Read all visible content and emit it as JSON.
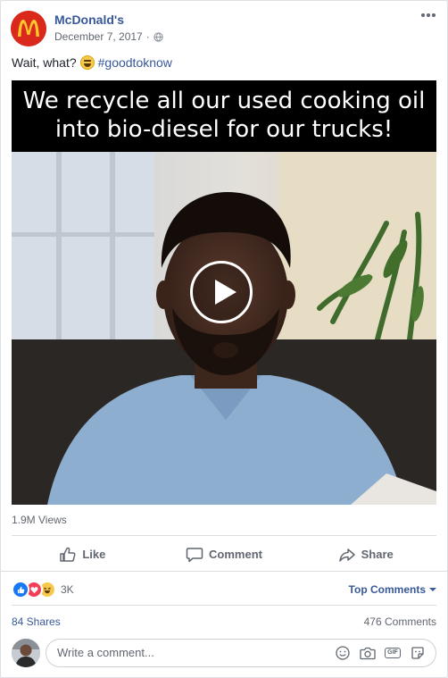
{
  "post": {
    "page_name": "McDonald's",
    "date": "December 7, 2017",
    "privacy_icon": "globe-icon",
    "more_icon": "ellipsis-icon",
    "caption_text": "Wait, what?",
    "caption_emoji": "laughing-face",
    "hashtag": "#goodtoknow"
  },
  "video": {
    "overlay_line1": "We recycle all our used cooking oil",
    "overlay_line2": "into bio-diesel for our trucks!",
    "views": "1.9M Views"
  },
  "actions": {
    "like": "Like",
    "comment": "Comment",
    "share": "Share"
  },
  "reactions": {
    "count": "3K",
    "types": [
      "like",
      "love",
      "haha"
    ],
    "sort_label": "Top Comments"
  },
  "stats": {
    "shares": "84 Shares",
    "comments": "476 Comments"
  },
  "composer": {
    "placeholder": "Write a comment..."
  },
  "colors": {
    "link": "#385898",
    "brand_red": "#da291c",
    "brand_gold": "#ffc72c",
    "like_blue": "#1877f2",
    "love_red": "#f33e58"
  }
}
